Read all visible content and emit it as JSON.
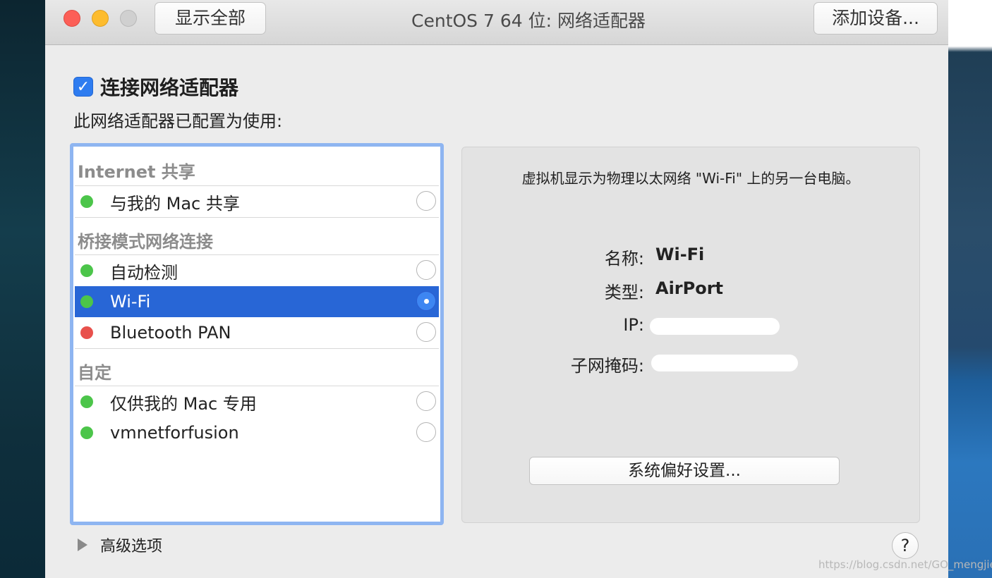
{
  "window": {
    "title": "CentOS 7 64 位: 网络适配器",
    "show_all_label": "显示全部",
    "add_device_label": "添加设备..."
  },
  "connect": {
    "checked": true,
    "label": "连接网络适配器"
  },
  "config_text": "此网络适配器已配置为使用:",
  "adapter_list": {
    "sections": [
      {
        "header": "Internet 共享",
        "items": [
          {
            "label": "与我的 Mac 共享",
            "status": "green",
            "selected": false
          }
        ]
      },
      {
        "header": "桥接模式网络连接",
        "items": [
          {
            "label": "自动检测",
            "status": "green",
            "selected": false
          },
          {
            "label": "Wi-Fi",
            "status": "green",
            "selected": true
          },
          {
            "label": "Bluetooth PAN",
            "status": "red",
            "selected": false
          }
        ]
      },
      {
        "header": "自定",
        "items": [
          {
            "label": "仅供我的 Mac 专用",
            "status": "green",
            "selected": false
          },
          {
            "label": "vmnetforfusion",
            "status": "green",
            "selected": false
          }
        ]
      }
    ]
  },
  "details": {
    "description": "虚拟机显示为物理以太网络 \"Wi-Fi\" 上的另一台电脑。",
    "name_label": "名称:",
    "name_value": "Wi-Fi",
    "type_label": "类型:",
    "type_value": "AirPort",
    "ip_label": "IP:",
    "subnet_label": "子网掩码:",
    "system_prefs_label": "系统偏好设置..."
  },
  "advanced_label": "高级选项",
  "help_label": "?",
  "watermark": "https://blog.csdn.net/GO_mengjie",
  "colors": {
    "selection": "#2866d6",
    "status_green": "#4cc54a",
    "status_red": "#e8514c",
    "focus_ring": "#8eb5f1"
  }
}
